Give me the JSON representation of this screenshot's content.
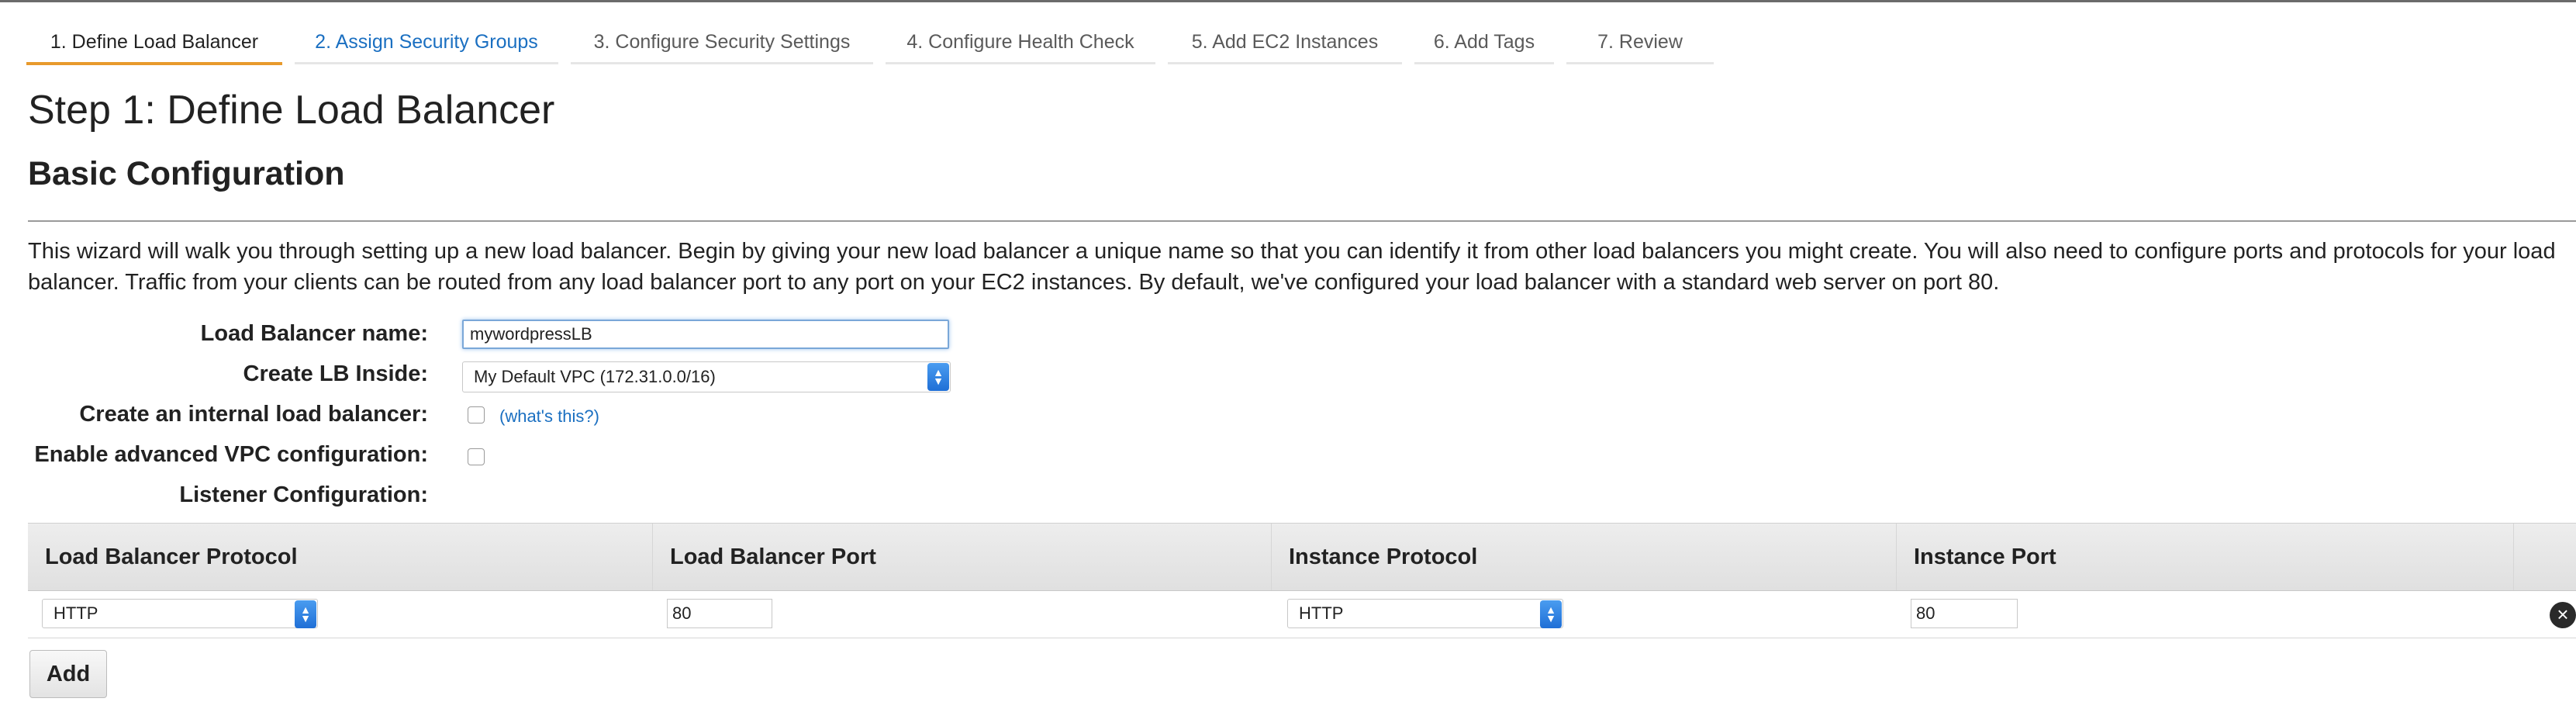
{
  "wizard": {
    "tabs": [
      {
        "label": "1. Define Load Balancer"
      },
      {
        "label": "2. Assign Security Groups"
      },
      {
        "label": "3. Configure Security Settings"
      },
      {
        "label": "4. Configure Health Check"
      },
      {
        "label": "5. Add EC2 Instances"
      },
      {
        "label": "6. Add Tags"
      },
      {
        "label": "7. Review"
      }
    ],
    "active_index": 0
  },
  "page": {
    "step_title": "Step 1: Define Load Balancer",
    "section_title": "Basic Configuration",
    "description": "This wizard will walk you through setting up a new load balancer. Begin by giving your new load balancer a unique name so that you can identify it from other load balancers you might create. You will also need to configure ports and protocols for your load balancer. Traffic from your clients can be routed from any load balancer port to any port on your EC2 instances. By default, we've configured your load balancer with a standard web server on port 80."
  },
  "form": {
    "name_label": "Load Balancer name:",
    "name_value": "mywordpressLB",
    "inside_label": "Create LB Inside:",
    "inside_value": "My Default VPC (172.31.0.0/16)",
    "internal_label": "Create an internal load balancer:",
    "internal_checked": false,
    "whats_this": "(what's this?)",
    "advanced_label": "Enable advanced VPC configuration:",
    "advanced_checked": false,
    "listener_label": "Listener Configuration:"
  },
  "listener_table": {
    "columns": [
      "Load Balancer Protocol",
      "Load Balancer Port",
      "Instance Protocol",
      "Instance Port"
    ],
    "rows": [
      {
        "lb_protocol": "HTTP",
        "lb_port": "80",
        "instance_protocol": "HTTP",
        "instance_port": "80"
      }
    ],
    "add_label": "Add"
  },
  "colors": {
    "accent_tab": "#e89a2c",
    "link": "#1a6fc1",
    "select_arrow": "#1f6fd6"
  }
}
